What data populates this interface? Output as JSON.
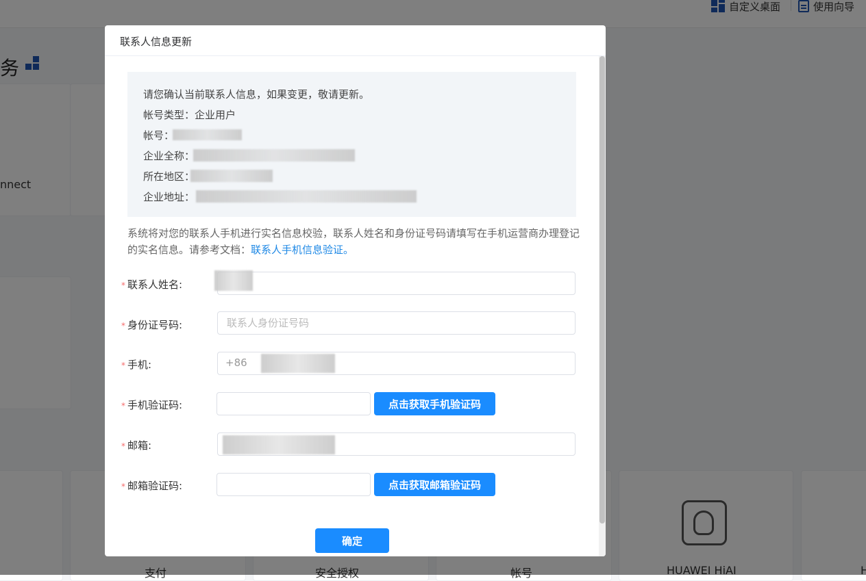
{
  "topbar": {
    "custom_desktop_label": "自定义桌面",
    "guide_label": "使用向导"
  },
  "background": {
    "section_title": "务",
    "card_connect_label": "nnect",
    "bottom_cards": [
      "支付",
      "安全授权",
      "帐号",
      "HUAWEI HiAI",
      "H"
    ]
  },
  "dialog": {
    "title": "联系人信息更新",
    "info": {
      "intro": "请您确认当前联系人信息，如果变更，敬请更新。",
      "account_type_label": "帐号类型：",
      "account_type_value": "企业用户",
      "account_label": "帐号：",
      "company_name_label": "企业全称：",
      "region_label": "所在地区：",
      "address_label": "企业地址："
    },
    "description": "系统将对您的联系人手机进行实名信息校验，联系人姓名和身份证号码请填写在手机运营商办理登记的实名信息。请参考文档：",
    "doc_link": "联系人手机信息验证。",
    "form": {
      "contact_name_label": "联系人姓名:",
      "id_number_label": "身份证号码:",
      "id_number_placeholder": "联系人身份证号码",
      "phone_label": "手机:",
      "phone_prefix": "+86",
      "phone_code_label": "手机验证码:",
      "get_phone_code_button": "点击获取手机验证码",
      "email_label": "邮箱:",
      "email_code_label": "邮箱验证码:",
      "get_email_code_button": "点击获取邮箱验证码",
      "required_mark": "*"
    },
    "confirm_button": "确定"
  },
  "colors": {
    "primary": "#1a8cff",
    "link": "#1e88e5",
    "required": "#f56c6c",
    "brand_icon": "#1e55b3"
  }
}
